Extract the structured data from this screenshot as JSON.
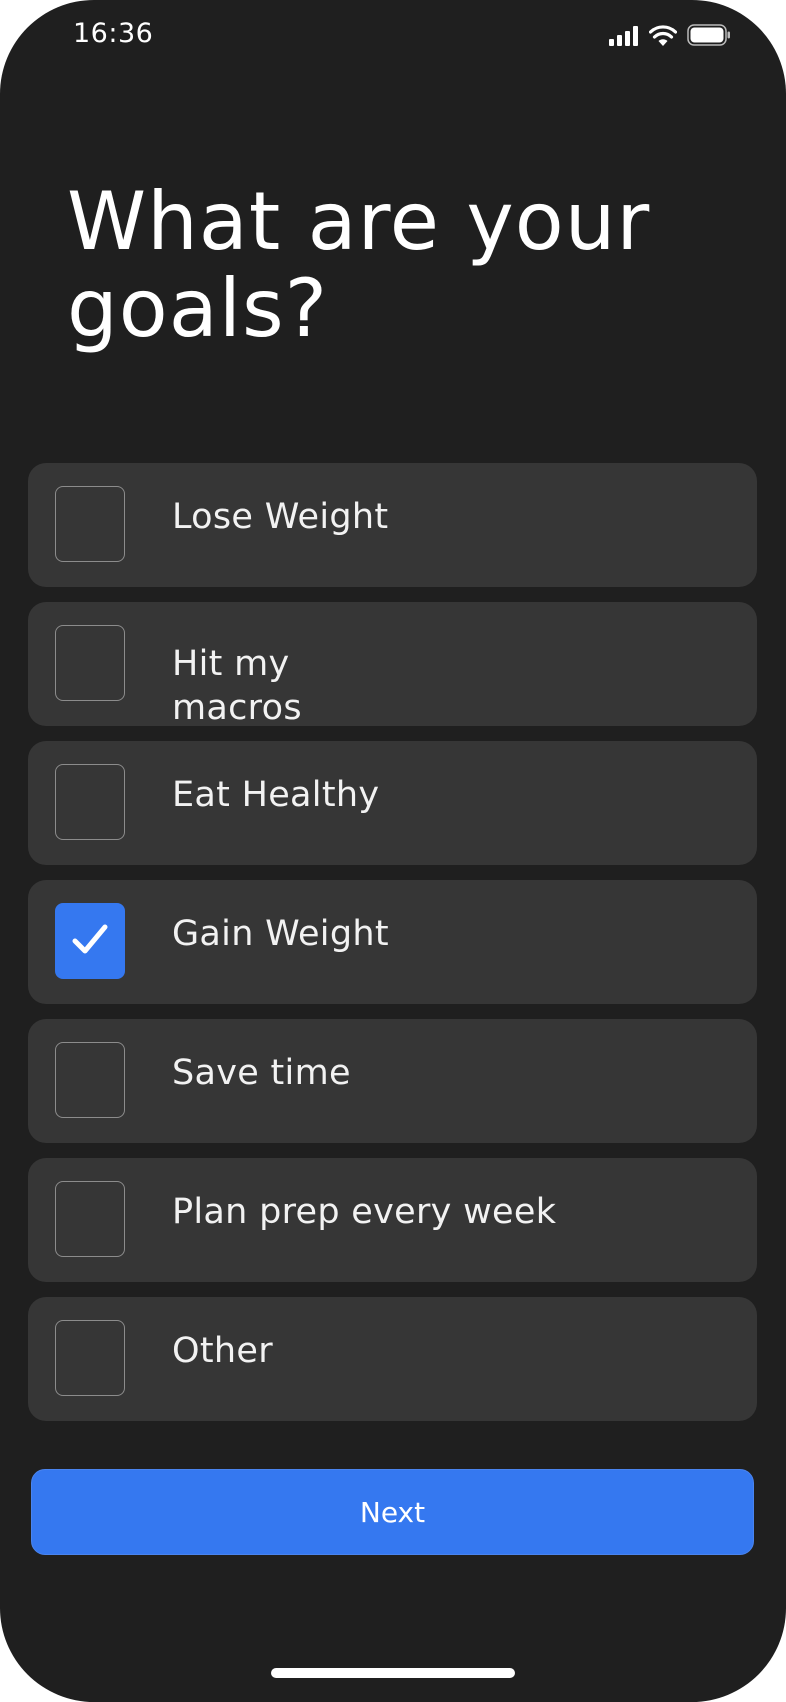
{
  "status_bar": {
    "time": "16:36",
    "icons": [
      "signal-icon",
      "wifi-icon",
      "battery-icon"
    ]
  },
  "title": "What are your goals?",
  "options": [
    {
      "label": "Lose Weight",
      "checked": false
    },
    {
      "label": "Hit my macros",
      "checked": false
    },
    {
      "label": "Eat Healthy",
      "checked": false
    },
    {
      "label": "Gain Weight",
      "checked": true
    },
    {
      "label": "Save time",
      "checked": false
    },
    {
      "label": "Plan prep every week",
      "checked": false
    },
    {
      "label": "Other",
      "checked": false
    }
  ],
  "next_label": "Next",
  "colors": {
    "background": "#1f1f1f",
    "card": "#363636",
    "accent": "#3578f0",
    "text": "#ffffff"
  }
}
